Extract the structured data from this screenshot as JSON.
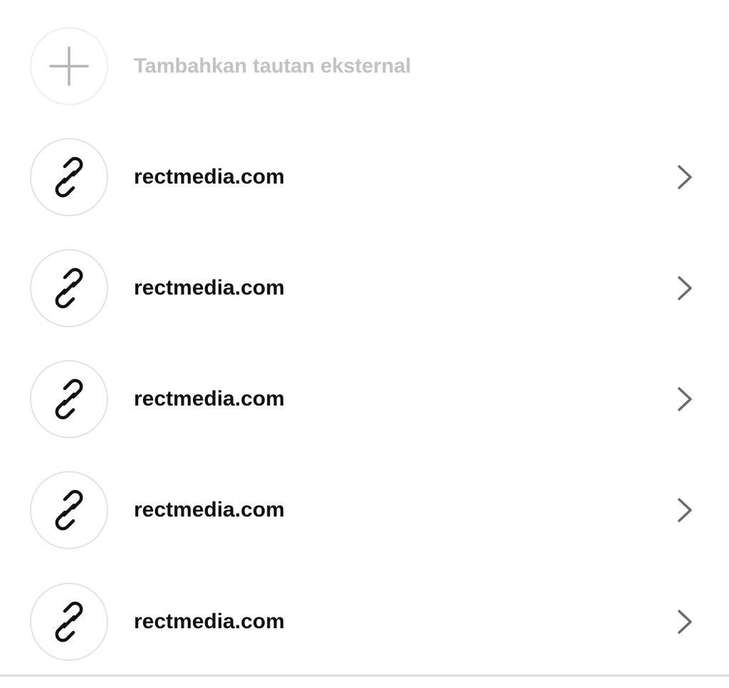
{
  "add_link": {
    "label": "Tambahkan tautan eksternal",
    "icon": "plus-icon"
  },
  "links": [
    {
      "label": "rectmedia.com",
      "icon": "link-icon"
    },
    {
      "label": "rectmedia.com",
      "icon": "link-icon"
    },
    {
      "label": "rectmedia.com",
      "icon": "link-icon"
    },
    {
      "label": "rectmedia.com",
      "icon": "link-icon"
    },
    {
      "label": "rectmedia.com",
      "icon": "link-icon"
    }
  ],
  "colors": {
    "text": "#111111",
    "muted_text": "#c2c2c2",
    "border": "#e3e3e3",
    "chevron": "#6b6b6b"
  }
}
